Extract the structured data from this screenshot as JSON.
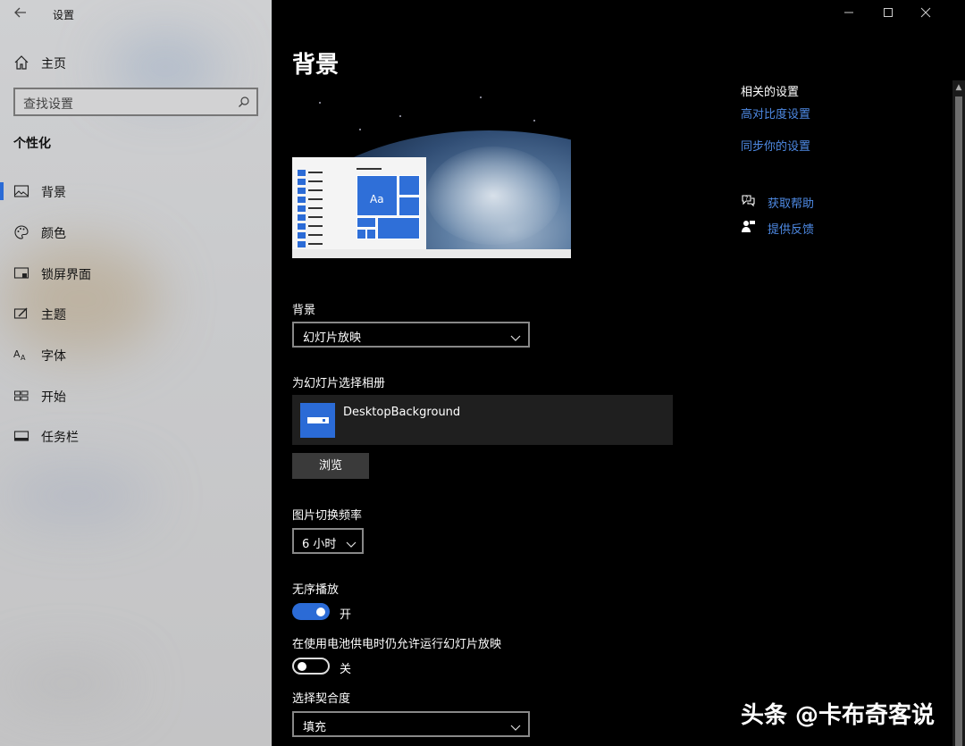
{
  "app": {
    "title": "设置"
  },
  "sidebar": {
    "home_label": "主页",
    "search_placeholder": "查找设置",
    "section_title": "个性化",
    "items": [
      {
        "label": "背景",
        "icon": "picture-icon",
        "active": true
      },
      {
        "label": "颜色",
        "icon": "palette-icon",
        "active": false
      },
      {
        "label": "锁屏界面",
        "icon": "lock-screen-icon",
        "active": false
      },
      {
        "label": "主题",
        "icon": "theme-icon",
        "active": false
      },
      {
        "label": "字体",
        "icon": "font-icon",
        "active": false
      },
      {
        "label": "开始",
        "icon": "start-icon",
        "active": false
      },
      {
        "label": "任务栏",
        "icon": "taskbar-icon",
        "active": false
      }
    ]
  },
  "main": {
    "title": "背景",
    "preview_tile_text": "Aa",
    "background_label": "背景",
    "background_value": "幻灯片放映",
    "album_label": "为幻灯片选择相册",
    "album_name": "DesktopBackground",
    "browse_label": "浏览",
    "frequency_label": "图片切换频率",
    "frequency_value": "6 小时",
    "shuffle_label": "无序播放",
    "shuffle_state": "开",
    "battery_label": "在使用电池供电时仍允许运行幻灯片放映",
    "battery_state": "关",
    "fit_label": "选择契合度",
    "fit_value": "填充"
  },
  "related": {
    "title": "相关的设置",
    "links": [
      "高对比度设置",
      "同步你的设置"
    ],
    "help": "获取帮助",
    "feedback": "提供反馈"
  },
  "watermark": "头条 @卡布奇客说",
  "colors": {
    "accent": "#2b6bd6",
    "link": "#4e8ae4",
    "background": "#000000",
    "sidebar": "#cfd0d2"
  }
}
